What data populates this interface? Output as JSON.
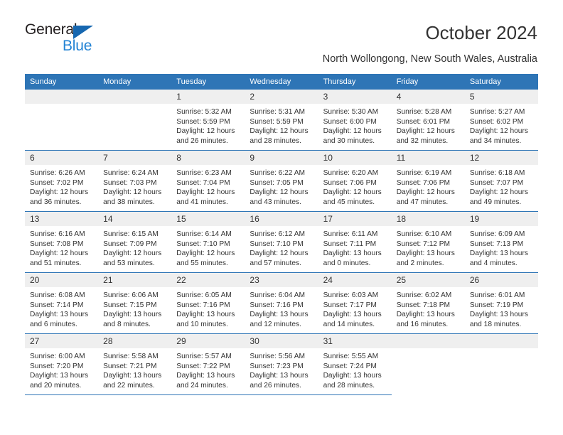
{
  "brand": {
    "name_part1": "General",
    "name_part2": "Blue",
    "triangle_icon": "blue-triangle-icon",
    "primary_color": "#2e75b6",
    "accent_color": "#2383d4"
  },
  "header": {
    "title": "October 2024",
    "subtitle": "North Wollongong, New South Wales, Australia"
  },
  "calendar": {
    "weekday_headers": [
      "Sunday",
      "Monday",
      "Tuesday",
      "Wednesday",
      "Thursday",
      "Friday",
      "Saturday"
    ],
    "header_bg": "#2e75b6",
    "daynum_bg": "#efefef",
    "weeks": [
      [
        {
          "day": "",
          "lines": []
        },
        {
          "day": "",
          "lines": []
        },
        {
          "day": "1",
          "lines": [
            "Sunrise: 5:32 AM",
            "Sunset: 5:59 PM",
            "Daylight: 12 hours",
            "and 26 minutes."
          ]
        },
        {
          "day": "2",
          "lines": [
            "Sunrise: 5:31 AM",
            "Sunset: 5:59 PM",
            "Daylight: 12 hours",
            "and 28 minutes."
          ]
        },
        {
          "day": "3",
          "lines": [
            "Sunrise: 5:30 AM",
            "Sunset: 6:00 PM",
            "Daylight: 12 hours",
            "and 30 minutes."
          ]
        },
        {
          "day": "4",
          "lines": [
            "Sunrise: 5:28 AM",
            "Sunset: 6:01 PM",
            "Daylight: 12 hours",
            "and 32 minutes."
          ]
        },
        {
          "day": "5",
          "lines": [
            "Sunrise: 5:27 AM",
            "Sunset: 6:02 PM",
            "Daylight: 12 hours",
            "and 34 minutes."
          ]
        }
      ],
      [
        {
          "day": "6",
          "lines": [
            "Sunrise: 6:26 AM",
            "Sunset: 7:02 PM",
            "Daylight: 12 hours",
            "and 36 minutes."
          ]
        },
        {
          "day": "7",
          "lines": [
            "Sunrise: 6:24 AM",
            "Sunset: 7:03 PM",
            "Daylight: 12 hours",
            "and 38 minutes."
          ]
        },
        {
          "day": "8",
          "lines": [
            "Sunrise: 6:23 AM",
            "Sunset: 7:04 PM",
            "Daylight: 12 hours",
            "and 41 minutes."
          ]
        },
        {
          "day": "9",
          "lines": [
            "Sunrise: 6:22 AM",
            "Sunset: 7:05 PM",
            "Daylight: 12 hours",
            "and 43 minutes."
          ]
        },
        {
          "day": "10",
          "lines": [
            "Sunrise: 6:20 AM",
            "Sunset: 7:06 PM",
            "Daylight: 12 hours",
            "and 45 minutes."
          ]
        },
        {
          "day": "11",
          "lines": [
            "Sunrise: 6:19 AM",
            "Sunset: 7:06 PM",
            "Daylight: 12 hours",
            "and 47 minutes."
          ]
        },
        {
          "day": "12",
          "lines": [
            "Sunrise: 6:18 AM",
            "Sunset: 7:07 PM",
            "Daylight: 12 hours",
            "and 49 minutes."
          ]
        }
      ],
      [
        {
          "day": "13",
          "lines": [
            "Sunrise: 6:16 AM",
            "Sunset: 7:08 PM",
            "Daylight: 12 hours",
            "and 51 minutes."
          ]
        },
        {
          "day": "14",
          "lines": [
            "Sunrise: 6:15 AM",
            "Sunset: 7:09 PM",
            "Daylight: 12 hours",
            "and 53 minutes."
          ]
        },
        {
          "day": "15",
          "lines": [
            "Sunrise: 6:14 AM",
            "Sunset: 7:10 PM",
            "Daylight: 12 hours",
            "and 55 minutes."
          ]
        },
        {
          "day": "16",
          "lines": [
            "Sunrise: 6:12 AM",
            "Sunset: 7:10 PM",
            "Daylight: 12 hours",
            "and 57 minutes."
          ]
        },
        {
          "day": "17",
          "lines": [
            "Sunrise: 6:11 AM",
            "Sunset: 7:11 PM",
            "Daylight: 13 hours",
            "and 0 minutes."
          ]
        },
        {
          "day": "18",
          "lines": [
            "Sunrise: 6:10 AM",
            "Sunset: 7:12 PM",
            "Daylight: 13 hours",
            "and 2 minutes."
          ]
        },
        {
          "day": "19",
          "lines": [
            "Sunrise: 6:09 AM",
            "Sunset: 7:13 PM",
            "Daylight: 13 hours",
            "and 4 minutes."
          ]
        }
      ],
      [
        {
          "day": "20",
          "lines": [
            "Sunrise: 6:08 AM",
            "Sunset: 7:14 PM",
            "Daylight: 13 hours",
            "and 6 minutes."
          ]
        },
        {
          "day": "21",
          "lines": [
            "Sunrise: 6:06 AM",
            "Sunset: 7:15 PM",
            "Daylight: 13 hours",
            "and 8 minutes."
          ]
        },
        {
          "day": "22",
          "lines": [
            "Sunrise: 6:05 AM",
            "Sunset: 7:16 PM",
            "Daylight: 13 hours",
            "and 10 minutes."
          ]
        },
        {
          "day": "23",
          "lines": [
            "Sunrise: 6:04 AM",
            "Sunset: 7:16 PM",
            "Daylight: 13 hours",
            "and 12 minutes."
          ]
        },
        {
          "day": "24",
          "lines": [
            "Sunrise: 6:03 AM",
            "Sunset: 7:17 PM",
            "Daylight: 13 hours",
            "and 14 minutes."
          ]
        },
        {
          "day": "25",
          "lines": [
            "Sunrise: 6:02 AM",
            "Sunset: 7:18 PM",
            "Daylight: 13 hours",
            "and 16 minutes."
          ]
        },
        {
          "day": "26",
          "lines": [
            "Sunrise: 6:01 AM",
            "Sunset: 7:19 PM",
            "Daylight: 13 hours",
            "and 18 minutes."
          ]
        }
      ],
      [
        {
          "day": "27",
          "lines": [
            "Sunrise: 6:00 AM",
            "Sunset: 7:20 PM",
            "Daylight: 13 hours",
            "and 20 minutes."
          ]
        },
        {
          "day": "28",
          "lines": [
            "Sunrise: 5:58 AM",
            "Sunset: 7:21 PM",
            "Daylight: 13 hours",
            "and 22 minutes."
          ]
        },
        {
          "day": "29",
          "lines": [
            "Sunrise: 5:57 AM",
            "Sunset: 7:22 PM",
            "Daylight: 13 hours",
            "and 24 minutes."
          ]
        },
        {
          "day": "30",
          "lines": [
            "Sunrise: 5:56 AM",
            "Sunset: 7:23 PM",
            "Daylight: 13 hours",
            "and 26 minutes."
          ]
        },
        {
          "day": "31",
          "lines": [
            "Sunrise: 5:55 AM",
            "Sunset: 7:24 PM",
            "Daylight: 13 hours",
            "and 28 minutes."
          ]
        },
        {
          "day": "",
          "lines": []
        },
        {
          "day": "",
          "lines": []
        }
      ]
    ]
  }
}
